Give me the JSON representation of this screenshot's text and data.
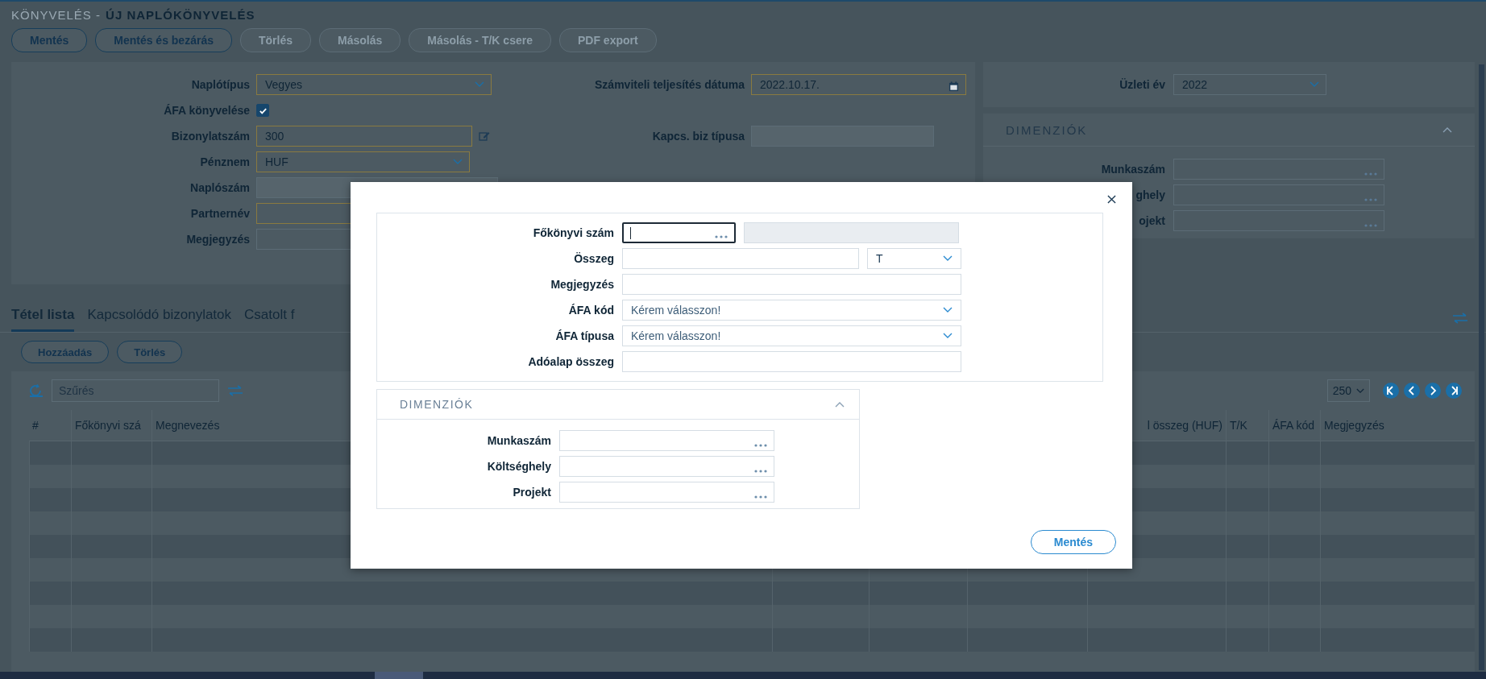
{
  "header": {
    "section": "KÖNYVELÉS -",
    "title": "ÚJ NAPLÓKÖNYVELÉS"
  },
  "toolbar": [
    {
      "label": "Mentés",
      "disabled": false
    },
    {
      "label": "Mentés és bezárás",
      "disabled": false
    },
    {
      "label": "Törlés",
      "disabled": true
    },
    {
      "label": "Másolás",
      "disabled": true
    },
    {
      "label": "Másolás - T/K csere",
      "disabled": true
    },
    {
      "label": "PDF export",
      "disabled": true
    }
  ],
  "form": {
    "left_fields": [
      {
        "kind": "select",
        "label": "Naplótípus",
        "value": "Vegyes",
        "required": true
      },
      {
        "kind": "checkbox",
        "label": "ÁFA könyvelése",
        "checked": true
      },
      {
        "kind": "editable",
        "label": "Bizonylatszám",
        "value": "300",
        "required": true
      },
      {
        "kind": "select",
        "label": "Pénznem",
        "value": "HUF",
        "required": true
      },
      {
        "kind": "readonly",
        "label": "Naplószám"
      },
      {
        "kind": "text",
        "label": "Partnernév",
        "required": true
      },
      {
        "kind": "text",
        "label": "Megjegyzés",
        "required": false
      }
    ],
    "middle_fields": [
      {
        "kind": "date",
        "label": "Számviteli teljesítés dátuma",
        "value": "2022.10.17.",
        "required": true
      },
      {
        "kind": "readonly",
        "label": "Kapcs. biz típusa"
      }
    ],
    "business_year": {
      "label": "Üzleti év",
      "value": "2022"
    },
    "dimensions": {
      "title": "DIMENZIÓK",
      "expanded": true,
      "fields": [
        {
          "label": "Munkaszám"
        },
        {
          "label": "ghely"
        },
        {
          "label": "ojekt"
        }
      ]
    }
  },
  "tabs": [
    {
      "label": "Tétel lista",
      "selected": true
    },
    {
      "label": "Kapcsolódó bizonylatok",
      "selected": false
    },
    {
      "label": "Csatolt f",
      "selected": false
    }
  ],
  "list_buttons": [
    "Hozzáadás",
    "Törlés"
  ],
  "filter": {
    "placeholder": "Szűrés"
  },
  "page_size": "250",
  "table": {
    "columns": [
      "#",
      "Főkönyvi szá",
      "Megnevezés",
      "l összeg (HUF)",
      "T/K",
      "ÁFA kód",
      "Megjegyzés"
    ]
  },
  "modal": {
    "fields": [
      {
        "kind": "lookup",
        "label": "Főkönyvi szám",
        "focused": true
      },
      {
        "kind": "amount",
        "label": "Összeg",
        "side": "T"
      },
      {
        "kind": "text",
        "label": "Megjegyzés"
      },
      {
        "kind": "select",
        "label": "ÁFA kód",
        "placeholder": "Kérem válasszon!"
      },
      {
        "kind": "select",
        "label": "ÁFA típusa",
        "placeholder": "Kérem válasszon!"
      },
      {
        "kind": "text",
        "label": "Adóalap összeg"
      }
    ],
    "dimensions": {
      "title": "DIMENZIÓK",
      "expanded": true,
      "fields": [
        {
          "label": "Munkaszám"
        },
        {
          "label": "Költséghely"
        },
        {
          "label": "Projekt"
        }
      ]
    },
    "save_button": "Mentés"
  }
}
